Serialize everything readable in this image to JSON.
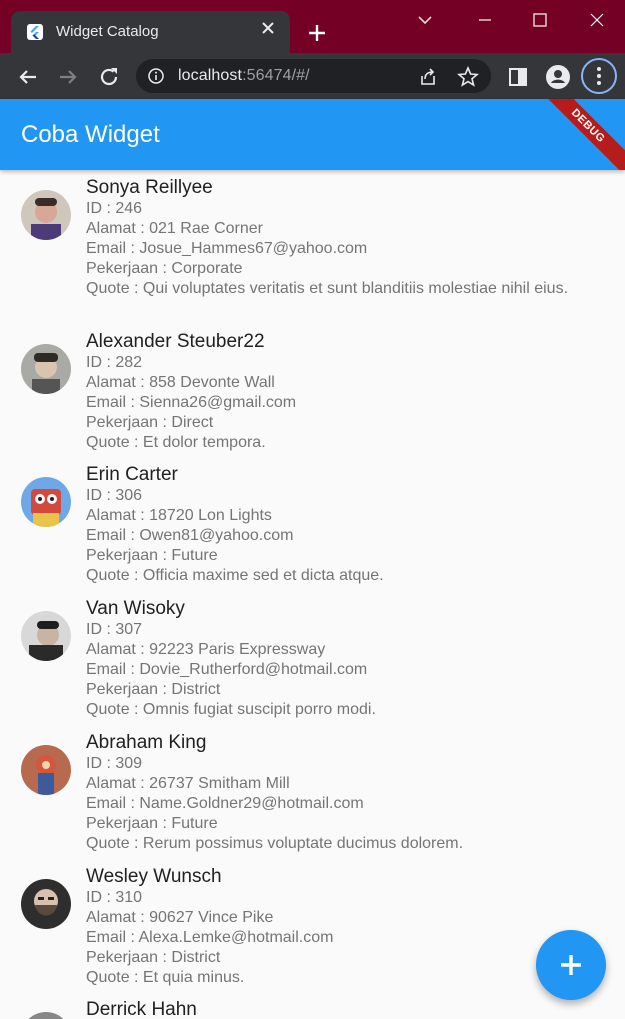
{
  "browser": {
    "tab_title": "Widget Catalog",
    "new_tab_label": "+",
    "url_host": "localhost",
    "url_rest": ":56474/#/"
  },
  "app": {
    "title": "Coba Widget",
    "debug_banner": "DEBUG",
    "primary_color": "#2196f3"
  },
  "people": [
    {
      "name": "Sonya Reillyee",
      "id_line": "ID : 246",
      "address_line": "Alamat : 021 Rae Corner",
      "email_line": "Email : Josue_Hammes67@yahoo.com",
      "job_line": "Pekerjaan : Corporate",
      "quote_line": "Quote : Qui voluptates veritatis et sunt blanditiis molestiae nihil eius.",
      "avatar_color": "#b9a99a"
    },
    {
      "name": "Alexander Steuber22",
      "id_line": "ID : 282",
      "address_line": "Alamat : 858 Devonte Wall",
      "email_line": "Email : Sienna26@gmail.com",
      "job_line": "Pekerjaan : Direct",
      "quote_line": "Quote : Et dolor tempora.",
      "avatar_color": "#9a9a96"
    },
    {
      "name": "Erin Carter",
      "id_line": "ID : 306",
      "address_line": "Alamat : 18720 Lon Lights",
      "email_line": "Email : Owen81@yahoo.com",
      "job_line": "Pekerjaan : Future",
      "quote_line": "Quote : Officia maxime sed et dicta atque.",
      "avatar_color": "#5b8fd4"
    },
    {
      "name": "Van Wisoky",
      "id_line": "ID : 307",
      "address_line": "Alamat : 92223 Paris Expressway",
      "email_line": "Email : Dovie_Rutherford@hotmail.com",
      "job_line": "Pekerjaan : District",
      "quote_line": "Quote : Omnis fugiat suscipit porro modi.",
      "avatar_color": "#4a4a4a"
    },
    {
      "name": "Abraham King",
      "id_line": "ID : 309",
      "address_line": "Alamat : 26737 Smitham Mill",
      "email_line": "Email : Name.Goldner29@hotmail.com",
      "job_line": "Pekerjaan : Future",
      "quote_line": "Quote : Rerum possimus voluptate ducimus dolorem.",
      "avatar_color": "#c0584a"
    },
    {
      "name": "Wesley Wunsch",
      "id_line": "ID : 310",
      "address_line": "Alamat : 90627 Vince Pike",
      "email_line": "Email : Alexa.Lemke@hotmail.com",
      "job_line": "Pekerjaan : District",
      "quote_line": "Quote : Et quia minus.",
      "avatar_color": "#3a3a3a"
    },
    {
      "name": "Derrick Hahn",
      "id_line": "",
      "address_line": "",
      "email_line": "",
      "job_line": "",
      "quote_line": "",
      "avatar_color": "#888888"
    }
  ],
  "fab": {
    "label": "+",
    "icon": "add-icon"
  }
}
